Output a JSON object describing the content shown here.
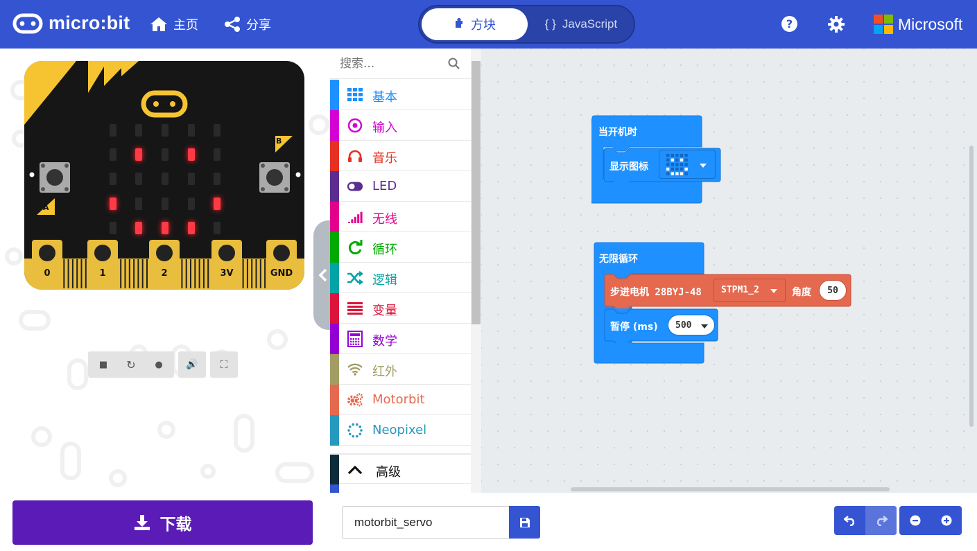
{
  "header": {
    "brand": "micro:bit",
    "home_label": "主页",
    "share_label": "分享",
    "mode_blocks": "方块",
    "mode_js": "JavaScript",
    "ms_label": "Microsoft",
    "help_icon": "help-icon",
    "settings_icon": "gear-icon"
  },
  "colors": {
    "brand_blue": "#3454d1",
    "download_purple": "#5a1bb7",
    "block_blue": "#1e90ff",
    "motor_orange": "#e5694f"
  },
  "simulator": {
    "pins": [
      "0",
      "1",
      "2",
      "3V",
      "GND"
    ],
    "button_a": "A",
    "button_b": "B",
    "led_on_cells": [
      [
        1,
        1
      ],
      [
        1,
        3
      ],
      [
        3,
        0
      ],
      [
        3,
        4
      ],
      [
        4,
        1
      ],
      [
        4,
        2
      ],
      [
        4,
        3
      ]
    ],
    "controls": [
      "stop-icon",
      "restart-icon",
      "debug-icon",
      "mute-icon",
      "fullscreen-icon"
    ]
  },
  "toolbox": {
    "search_placeholder": "搜索...",
    "categories": [
      {
        "label": "基本",
        "color": "#1e90ff",
        "icon": "grid-icon"
      },
      {
        "label": "输入",
        "color": "#d400d4",
        "icon": "target-icon"
      },
      {
        "label": "音乐",
        "color": "#e63022",
        "icon": "headphones-icon"
      },
      {
        "label": "LED",
        "color": "#5c2d91",
        "icon": "toggle-icon"
      },
      {
        "label": "无线",
        "color": "#e3008c",
        "icon": "signal-icon"
      },
      {
        "label": "循环",
        "color": "#00aa00",
        "icon": "refresh-icon"
      },
      {
        "label": "逻辑",
        "color": "#00a4a6",
        "icon": "shuffle-icon"
      },
      {
        "label": "变量",
        "color": "#dc143c",
        "icon": "list-icon"
      },
      {
        "label": "数学",
        "color": "#9400d3",
        "icon": "calculator-icon"
      },
      {
        "label": "红外",
        "color": "#a29e63",
        "icon": "wifi-icon"
      },
      {
        "label": "Motorbit",
        "color": "#e5694f",
        "icon": "gears-icon"
      },
      {
        "label": "Neopixel",
        "color": "#2699bf",
        "icon": "dots-circle-icon"
      }
    ],
    "advanced_label": "高级"
  },
  "workspace": {
    "on_start_label": "当开机时",
    "show_icon_label": "显示图标",
    "forever_label": "无限循环",
    "stepper_label": "步进电机 28BYJ-48",
    "stepper_dropdown": "STPM1_2",
    "angle_label": "角度",
    "angle_value": "50",
    "pause_label": "暂停 (ms)",
    "pause_value": "500"
  },
  "footer": {
    "download_label": "下载",
    "project_name": "motorbit_servo"
  }
}
